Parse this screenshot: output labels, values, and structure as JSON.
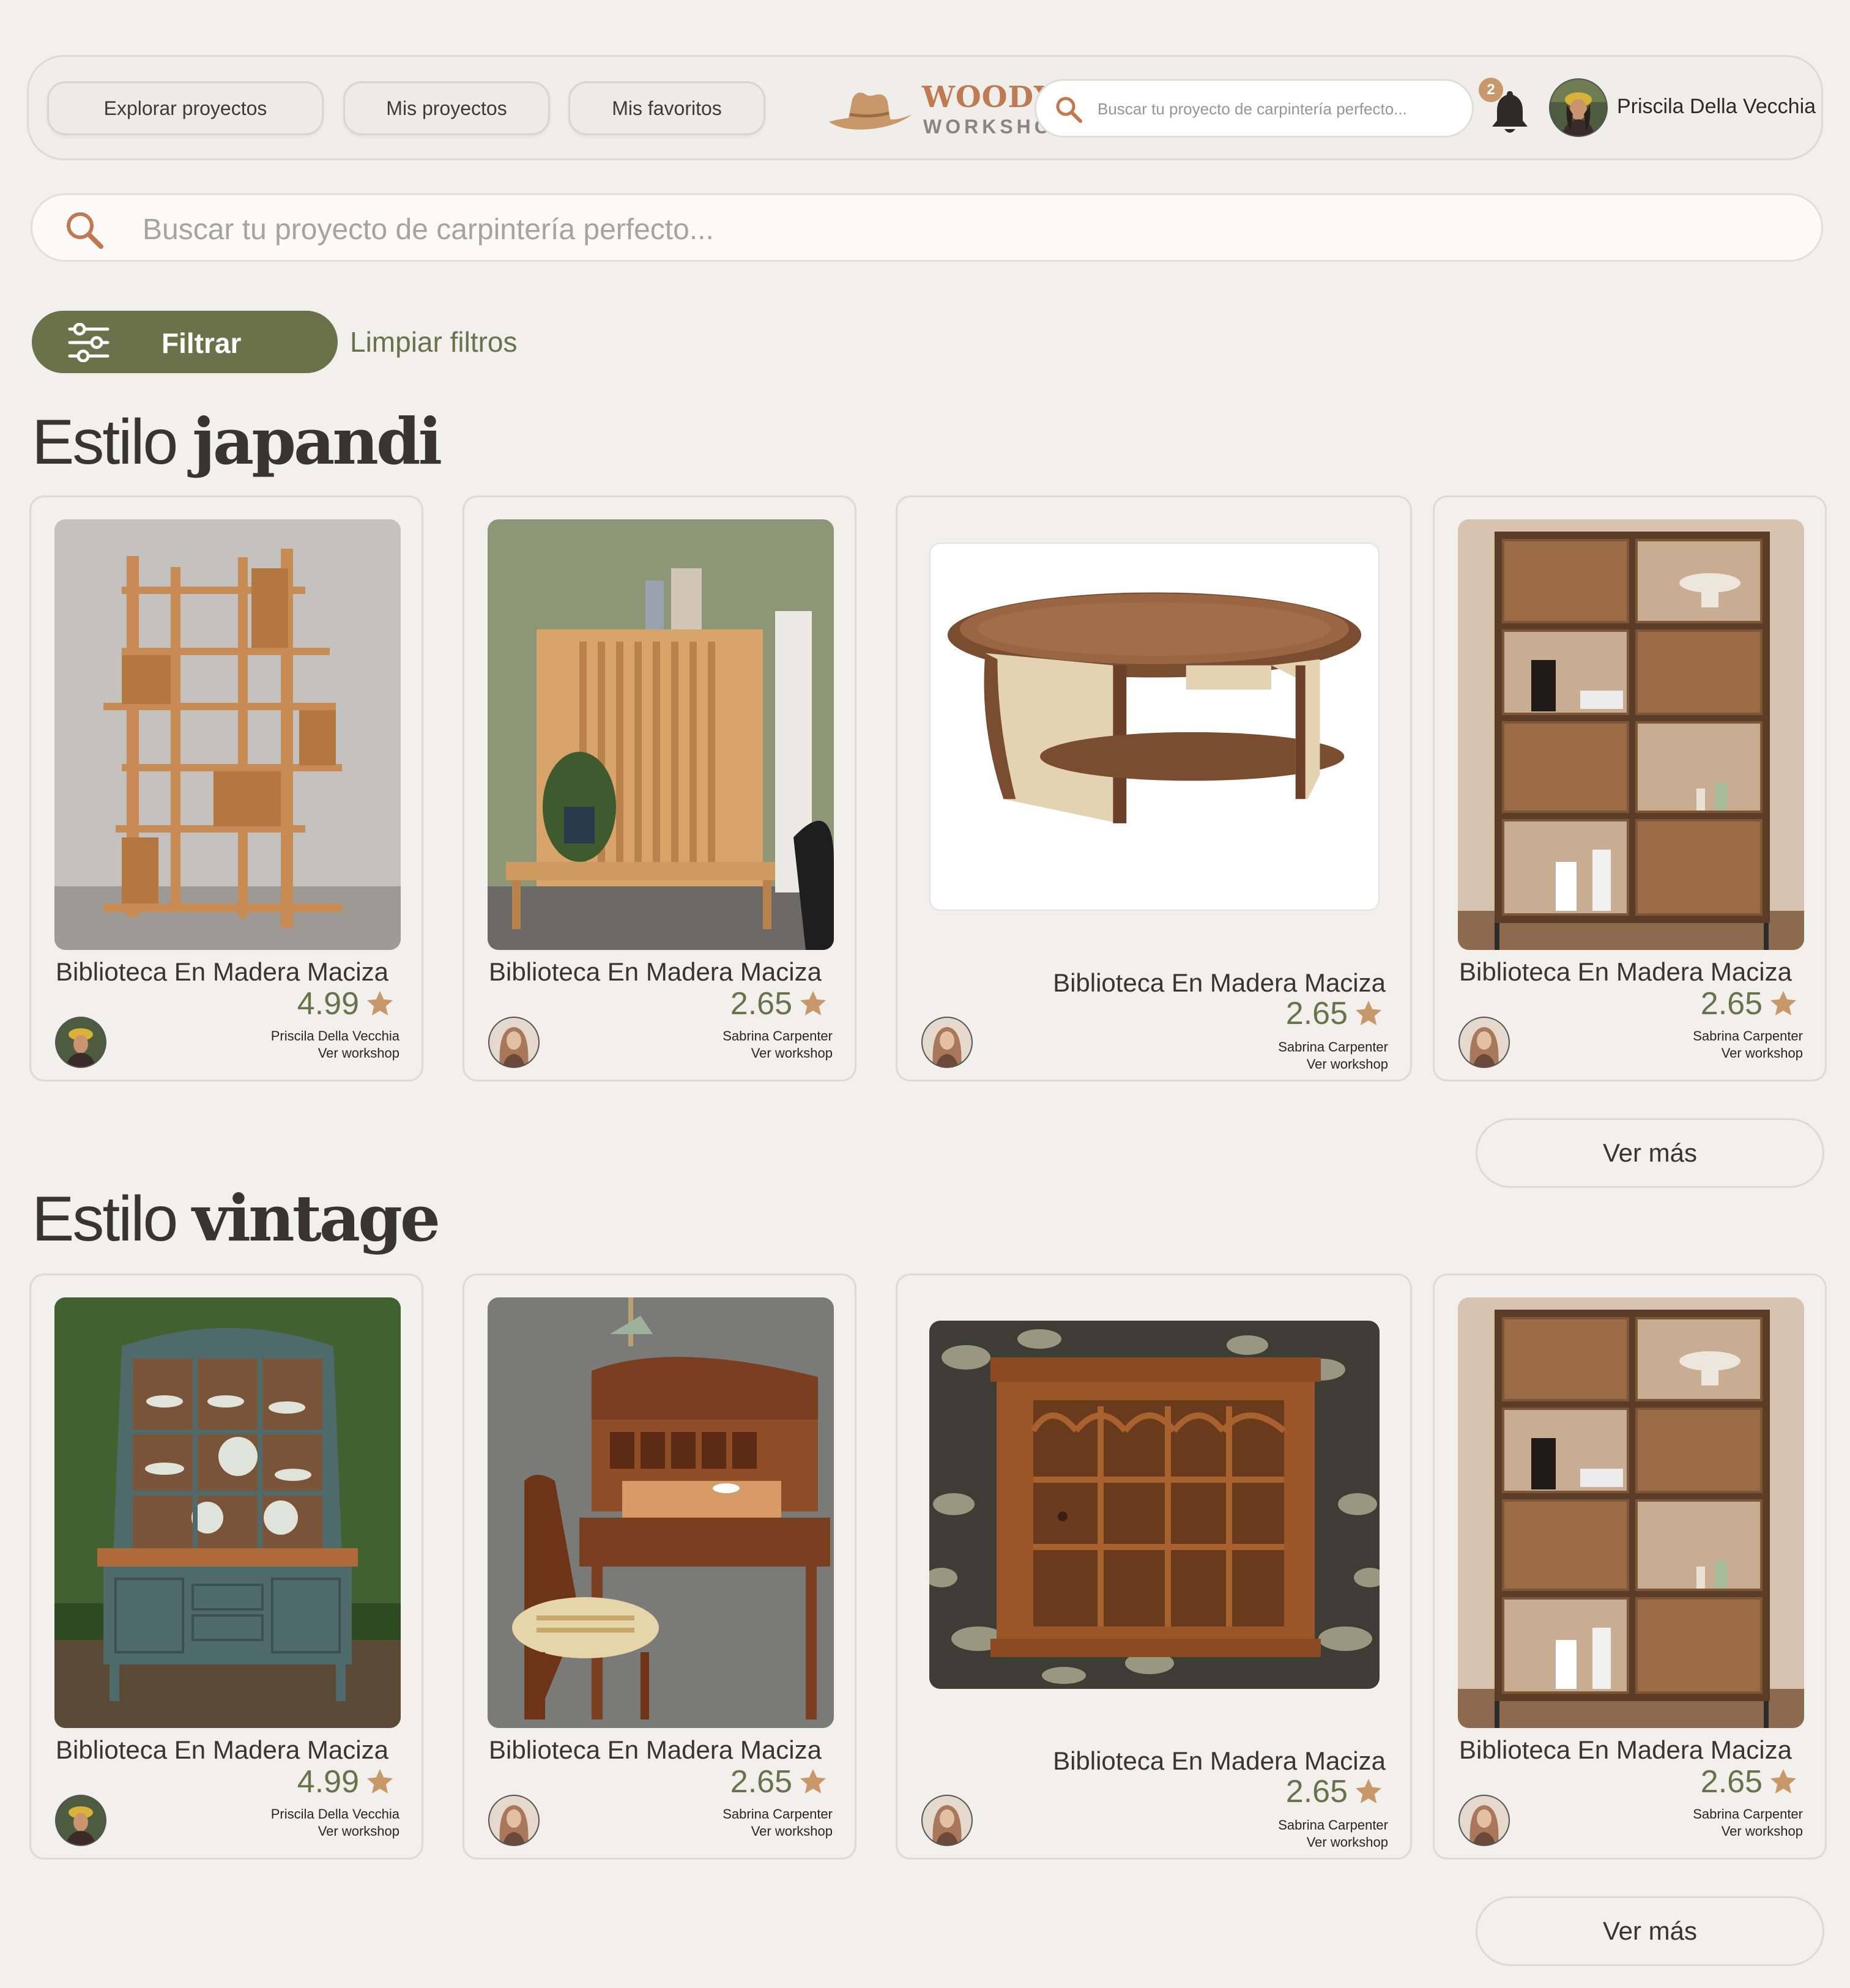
{
  "nav": {
    "explore_label": "Explorar proyectos",
    "my_projects_label": "Mis proyectos",
    "favorites_label": "Mis favoritos",
    "logo_title": "WOODY'S",
    "logo_subtitle": "WORKSHOP",
    "search_placeholder": "Buscar tu proyecto de carpintería perfecto...",
    "notification_count": "2",
    "user_name": "Priscila Della Vecchia"
  },
  "search": {
    "placeholder": "Buscar tu proyecto de carpintería perfecto..."
  },
  "filters": {
    "filter_label": "Filtrar",
    "clear_label": "Limpiar filtros"
  },
  "colors": {
    "olive": "#6b7149",
    "star": "#c9986a",
    "brand": "#c07a52",
    "background": "#f1f0ec"
  },
  "sections": [
    {
      "title_plain": "Estilo",
      "title_em": "japandi",
      "more_label": "Ver más",
      "cards": [
        {
          "title": "Biblioteca En Madera Maciza",
          "rating": "4.99",
          "author": "Priscila Della Vecchia",
          "workshop_link": "Ver workshop",
          "image": "japandi-slatted-bookshelf"
        },
        {
          "title": "Biblioteca En Madera Maciza",
          "rating": "2.65",
          "author": "Sabrina Carpenter",
          "workshop_link": "Ver workshop",
          "image": "japandi-slatted-cabinet"
        },
        {
          "title": "Biblioteca En Madera Maciza",
          "rating": "2.65",
          "author": "Sabrina Carpenter",
          "workshop_link": "Ver workshop",
          "image": "rattan-coffee-table"
        },
        {
          "title": "Biblioteca En Madera Maciza",
          "rating": "2.65",
          "author": "Sabrina Carpenter",
          "workshop_link": "Ver workshop",
          "image": "walnut-bookcase"
        }
      ]
    },
    {
      "title_plain": "Estilo",
      "title_em": "vintage",
      "more_label": "Ver más",
      "cards": [
        {
          "title": "Biblioteca En Madera Maciza",
          "rating": "4.99",
          "author": "Priscila Della Vecchia",
          "workshop_link": "Ver workshop",
          "image": "blue-china-cabinet"
        },
        {
          "title": "Biblioteca En Madera Maciza",
          "rating": "2.65",
          "author": "Sabrina Carpenter",
          "workshop_link": "Ver workshop",
          "image": "rolltop-desk"
        },
        {
          "title": "Biblioteca En Madera Maciza",
          "rating": "2.65",
          "author": "Sabrina Carpenter",
          "workshop_link": "Ver workshop",
          "image": "wall-curio-cabinet"
        },
        {
          "title": "Biblioteca En Madera Maciza",
          "rating": "2.65",
          "author": "Sabrina Carpenter",
          "workshop_link": "Ver workshop",
          "image": "walnut-bookcase"
        }
      ]
    }
  ]
}
